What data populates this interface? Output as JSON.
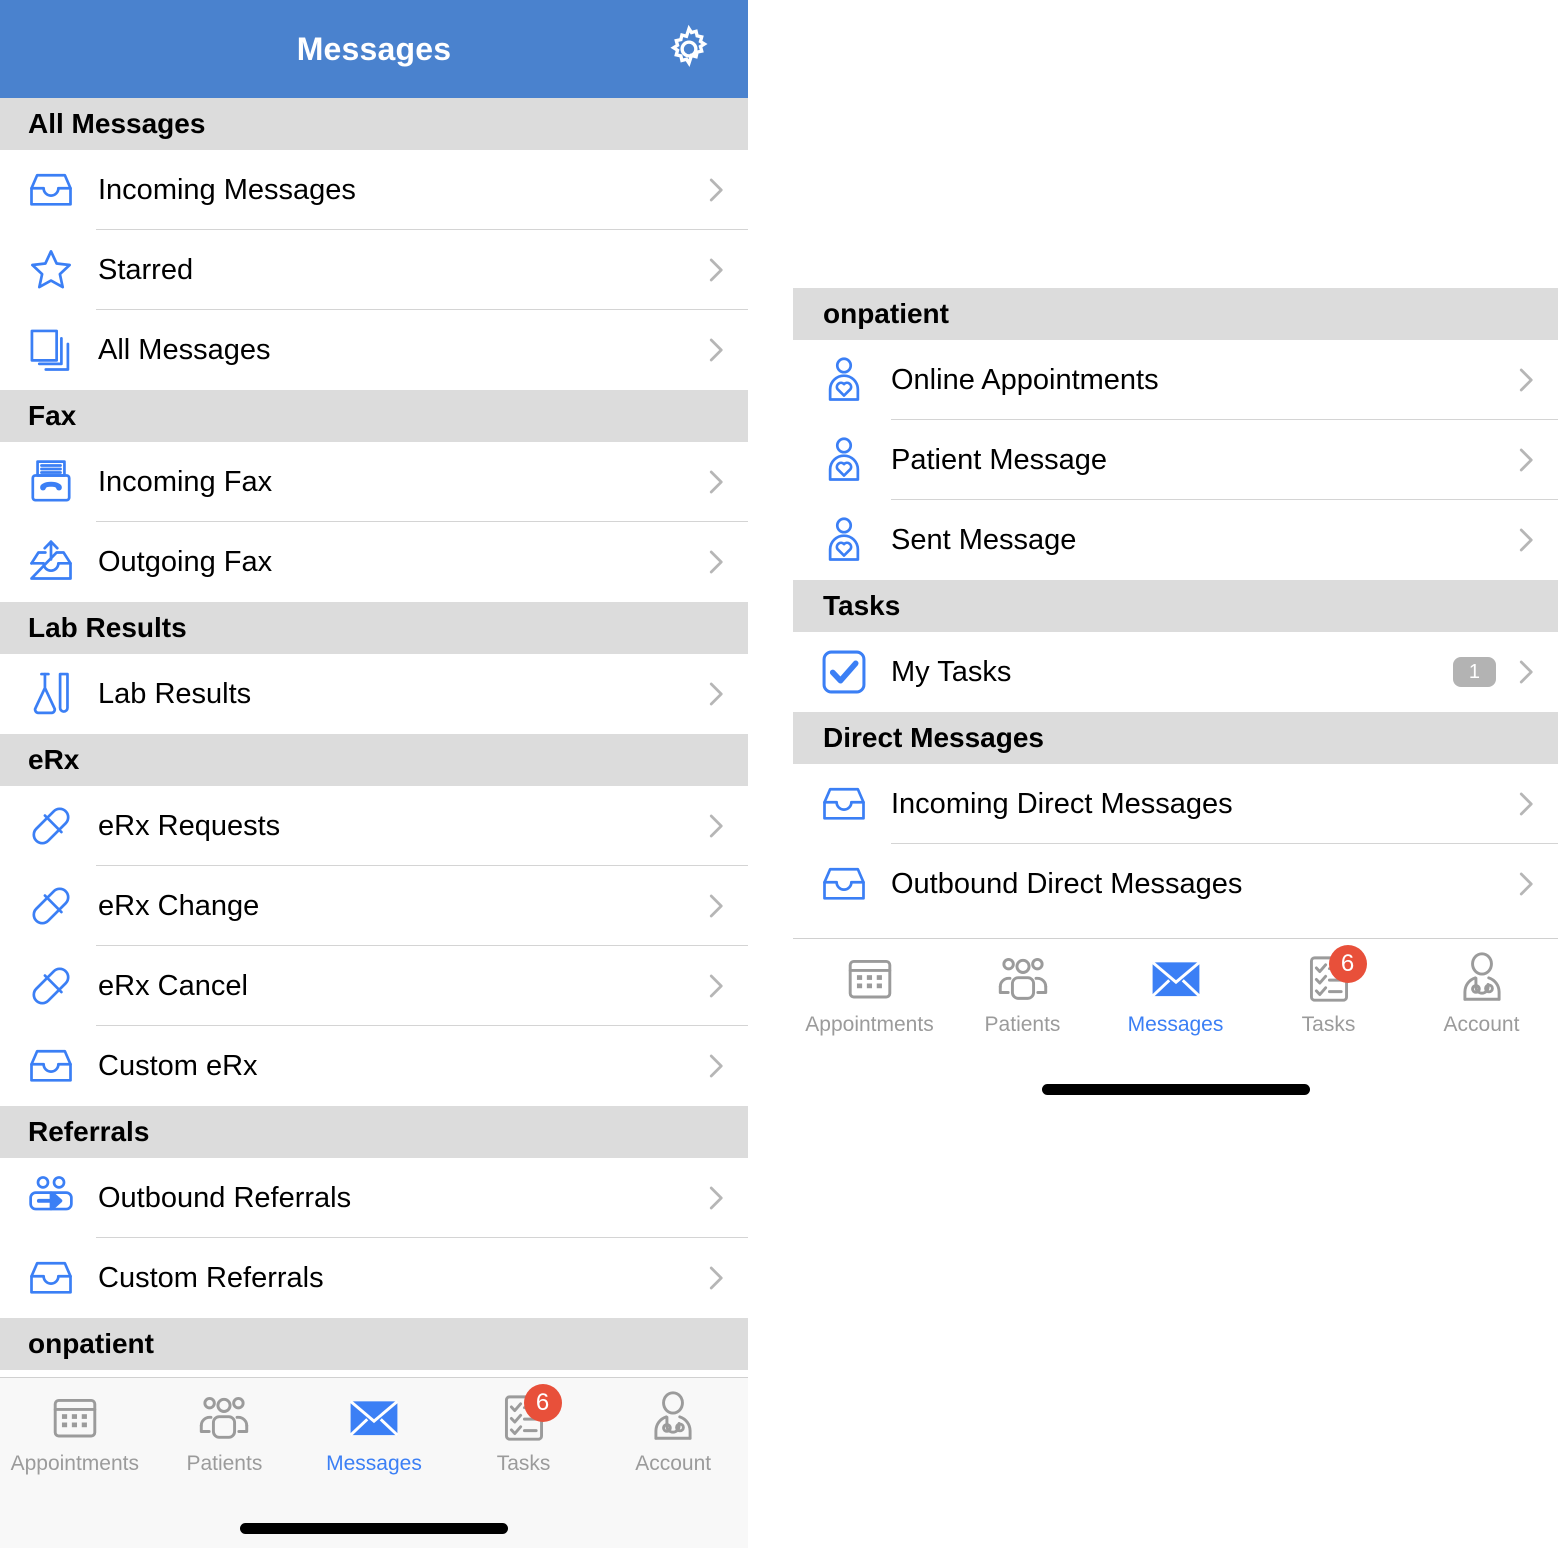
{
  "accent_blue": "#3b7ff5",
  "header_blue": "#4a82ce",
  "section_gray": "#dcdcdc",
  "badge_red": "#e8503a",
  "badge_gray": "#b3b3b3",
  "left_panel": {
    "nav": {
      "title": "Messages",
      "settings_icon": "gear-icon"
    },
    "sections": [
      {
        "title": "All Messages",
        "rows": [
          {
            "label": "Incoming Messages",
            "icon": "inbox-tray-icon"
          },
          {
            "label": "Starred",
            "icon": "star-icon"
          },
          {
            "label": "All Messages",
            "icon": "stacked-pages-icon"
          }
        ]
      },
      {
        "title": "Fax",
        "rows": [
          {
            "label": "Incoming Fax",
            "icon": "fax-machine-icon"
          },
          {
            "label": "Outgoing Fax",
            "icon": "outbox-up-arrow-icon"
          }
        ]
      },
      {
        "title": "Lab Results",
        "rows": [
          {
            "label": "Lab Results",
            "icon": "flask-test-tube-icon"
          }
        ]
      },
      {
        "title": "eRx",
        "rows": [
          {
            "label": "eRx Requests",
            "icon": "pill-capsule-icon"
          },
          {
            "label": "eRx Change",
            "icon": "pill-capsule-icon"
          },
          {
            "label": "eRx Cancel",
            "icon": "pill-capsule-icon"
          },
          {
            "label": "Custom eRx",
            "icon": "inbox-tray-icon"
          }
        ]
      },
      {
        "title": "Referrals",
        "rows": [
          {
            "label": "Outbound Referrals",
            "icon": "two-people-arrow-icon"
          },
          {
            "label": "Custom Referrals",
            "icon": "inbox-tray-icon"
          }
        ]
      },
      {
        "title": "onpatient",
        "rows": []
      }
    ],
    "tabbar": {
      "tabs": [
        {
          "label": "Appointments",
          "icon": "calendar-icon",
          "active": false,
          "badge": ""
        },
        {
          "label": "Patients",
          "icon": "people-group-icon",
          "active": false,
          "badge": ""
        },
        {
          "label": "Messages",
          "icon": "envelope-icon",
          "active": true,
          "badge": ""
        },
        {
          "label": "Tasks",
          "icon": "checklist-icon",
          "active": false,
          "badge": "6"
        },
        {
          "label": "Account",
          "icon": "doctor-stethoscope-icon",
          "active": false,
          "badge": ""
        }
      ]
    }
  },
  "right_panel": {
    "sections": [
      {
        "title": "onpatient",
        "rows": [
          {
            "label": "Online Appointments",
            "icon": "patient-heart-icon",
            "badge": ""
          },
          {
            "label": "Patient Message",
            "icon": "patient-heart-icon",
            "badge": ""
          },
          {
            "label": "Sent Message",
            "icon": "patient-heart-icon",
            "badge": ""
          }
        ]
      },
      {
        "title": "Tasks",
        "rows": [
          {
            "label": "My Tasks",
            "icon": "checkbox-checked-icon",
            "badge": "1"
          }
        ]
      },
      {
        "title": "Direct Messages",
        "rows": [
          {
            "label": "Incoming Direct Messages",
            "icon": "inbox-tray-icon",
            "badge": ""
          },
          {
            "label": "Outbound Direct Messages",
            "icon": "inbox-tray-icon",
            "badge": ""
          }
        ]
      }
    ],
    "tabbar": {
      "tabs": [
        {
          "label": "Appointments",
          "icon": "calendar-icon",
          "active": false,
          "badge": ""
        },
        {
          "label": "Patients",
          "icon": "people-group-icon",
          "active": false,
          "badge": ""
        },
        {
          "label": "Messages",
          "icon": "envelope-icon",
          "active": true,
          "badge": ""
        },
        {
          "label": "Tasks",
          "icon": "checklist-icon",
          "active": false,
          "badge": "6"
        },
        {
          "label": "Account",
          "icon": "doctor-stethoscope-icon",
          "active": false,
          "badge": ""
        }
      ]
    }
  }
}
